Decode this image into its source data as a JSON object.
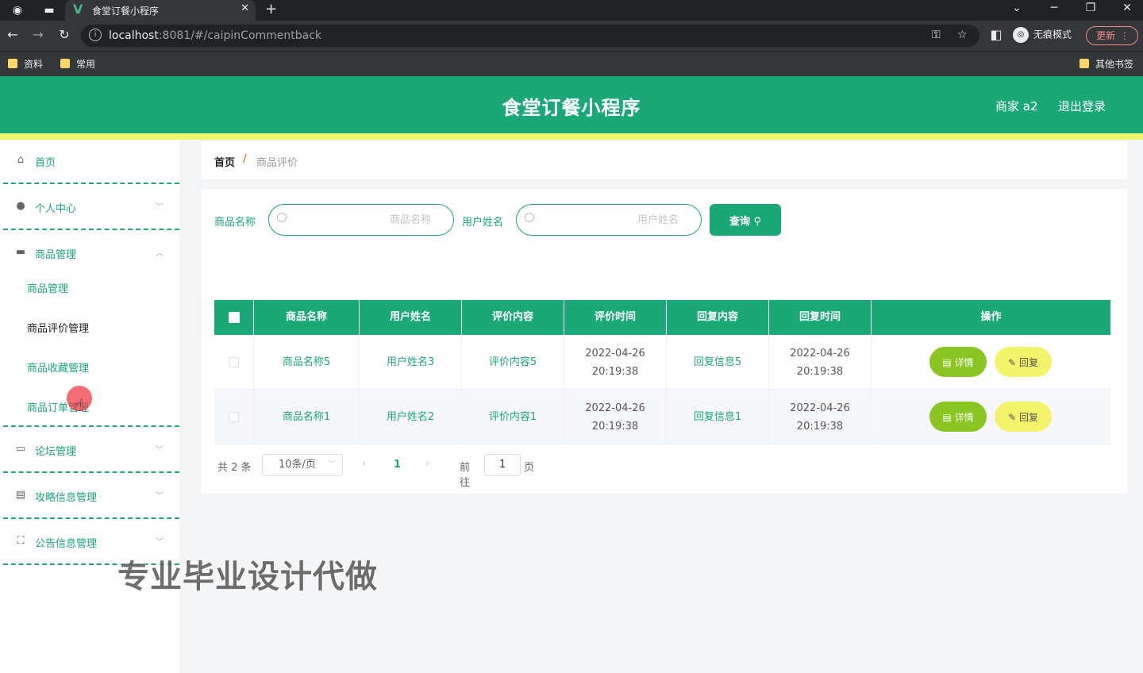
{
  "browser": {
    "tab_title": "食堂订餐小程序",
    "url_host": "localhost",
    "url_path": ":8081/#/caipinCommentback",
    "profile_label": "无痕模式",
    "update_label": "更新",
    "bookmarks": [
      "资料",
      "常用",
      "其他书签"
    ]
  },
  "header": {
    "title": "食堂订餐小程序",
    "user": "商家 a2",
    "logout": "退出登录",
    "accent_color": "#1aa876",
    "strip_color": "#f2f46b"
  },
  "sidebar": {
    "items": [
      {
        "label": "首页",
        "icon": "home-icon"
      },
      {
        "label": "个人中心",
        "icon": "user-icon"
      },
      {
        "label": "商品管理",
        "icon": "briefcase-icon"
      },
      {
        "label": "论坛管理",
        "icon": "forum-icon"
      },
      {
        "label": "攻略信息管理",
        "icon": "document-icon"
      },
      {
        "label": "公告信息管理",
        "icon": "frame-icon"
      }
    ],
    "sub_items": [
      "商品管理",
      "商品评价管理",
      "商品收藏管理",
      "商品订单管理"
    ]
  },
  "breadcrumb": {
    "home": "首页",
    "separator": "/",
    "current": "商品评价"
  },
  "search": {
    "product_label": "商品名称",
    "product_placeholder": "商品名称",
    "user_label": "用户姓名",
    "user_placeholder": "用户姓名",
    "query_label": "查询"
  },
  "table": {
    "columns": [
      "商品名称",
      "用户姓名",
      "评价内容",
      "评价时间",
      "回复内容",
      "回复时间",
      "操作"
    ],
    "rows": [
      {
        "product": "商品名称5",
        "user": "用户姓名3",
        "content": "评价内容5",
        "time": "2022-04-26 20:19:38",
        "reply": "回复信息5",
        "reply_time": "2022-04-26 20:19:38"
      },
      {
        "product": "商品名称1",
        "user": "用户姓名2",
        "content": "评价内容1",
        "time": "2022-04-26 20:19:38",
        "reply": "回复信息1",
        "reply_time": "2022-04-26 20:19:38"
      }
    ],
    "detail_label": "详情",
    "reply_label": "回复"
  },
  "pagination": {
    "total": "共 2 条",
    "page_size": "10条/页",
    "current_page": "1",
    "goto_label": "前往",
    "goto_value": "1",
    "page_unit": "页"
  },
  "watermark": "专业毕业设计代做"
}
